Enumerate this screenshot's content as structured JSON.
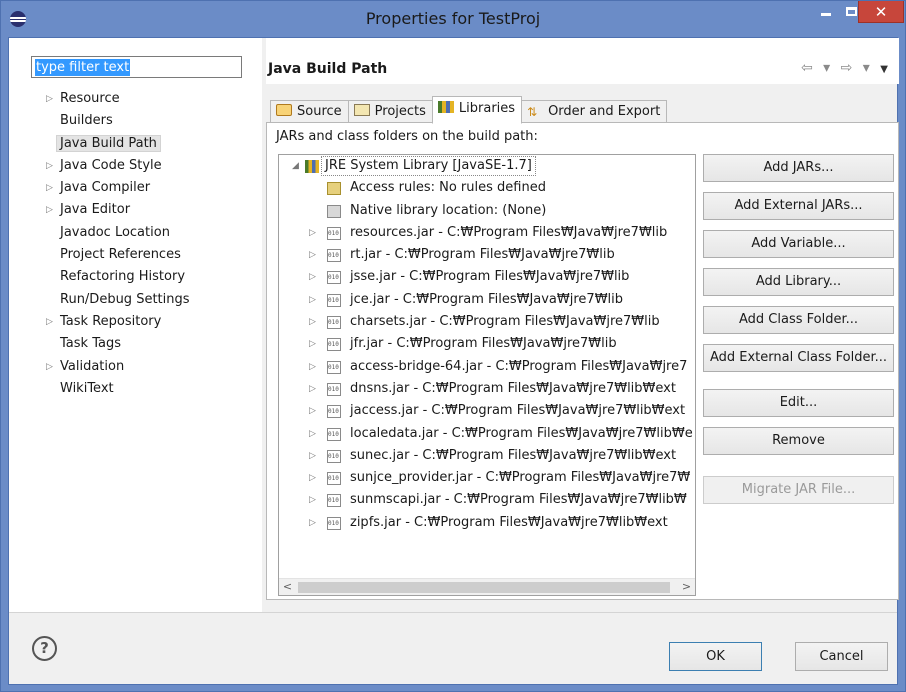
{
  "window": {
    "title": "Properties for TestProj",
    "minimize": "",
    "maximize": "",
    "close": "✕"
  },
  "left": {
    "filter_text": "type filter text",
    "items": [
      {
        "label": "Resource",
        "expandable": true
      },
      {
        "label": "Builders",
        "expandable": false
      },
      {
        "label": "Java Build Path",
        "expandable": false,
        "selected": true
      },
      {
        "label": "Java Code Style",
        "expandable": true
      },
      {
        "label": "Java Compiler",
        "expandable": true
      },
      {
        "label": "Java Editor",
        "expandable": true
      },
      {
        "label": "Javadoc Location",
        "expandable": false
      },
      {
        "label": "Project References",
        "expandable": false
      },
      {
        "label": "Refactoring History",
        "expandable": false
      },
      {
        "label": "Run/Debug Settings",
        "expandable": false
      },
      {
        "label": "Task Repository",
        "expandable": true
      },
      {
        "label": "Task Tags",
        "expandable": false
      },
      {
        "label": "Validation",
        "expandable": true
      },
      {
        "label": "WikiText",
        "expandable": false
      }
    ]
  },
  "page": {
    "title": "Java Build Path",
    "nav_arrows": "⇦ ▾ ⇨ ▾",
    "menu_arrow": "▼"
  },
  "tabs": [
    {
      "label": "Source",
      "active": false,
      "icon": "source-icon"
    },
    {
      "label": "Projects",
      "active": false,
      "icon": "projects-icon"
    },
    {
      "label": "Libraries",
      "active": true,
      "icon": "libraries-icon"
    },
    {
      "label": "Order and Export",
      "active": false,
      "icon": "order-icon"
    }
  ],
  "libraries": {
    "heading": "JARs and class folders on the build path:",
    "root": {
      "label": "JRE System Library [JavaSE-1.7]",
      "expanded": true
    },
    "children": [
      {
        "label": "Access rules: No rules defined",
        "icon": "access-rules-icon",
        "expandable": false
      },
      {
        "label": "Native library location: (None)",
        "icon": "native-library-icon",
        "expandable": false
      },
      {
        "label": "resources.jar - C:₩Program Files₩Java₩jre7₩lib",
        "icon": "jar-icon",
        "expandable": true
      },
      {
        "label": "rt.jar - C:₩Program Files₩Java₩jre7₩lib",
        "icon": "jar-icon",
        "expandable": true
      },
      {
        "label": "jsse.jar - C:₩Program Files₩Java₩jre7₩lib",
        "icon": "jar-icon",
        "expandable": true
      },
      {
        "label": "jce.jar - C:₩Program Files₩Java₩jre7₩lib",
        "icon": "jar-icon",
        "expandable": true
      },
      {
        "label": "charsets.jar - C:₩Program Files₩Java₩jre7₩lib",
        "icon": "jar-icon",
        "expandable": true
      },
      {
        "label": "jfr.jar - C:₩Program Files₩Java₩jre7₩lib",
        "icon": "jar-icon",
        "expandable": true
      },
      {
        "label": "access-bridge-64.jar - C:₩Program Files₩Java₩jre7",
        "icon": "jar-icon",
        "expandable": true
      },
      {
        "label": "dnsns.jar - C:₩Program Files₩Java₩jre7₩lib₩ext",
        "icon": "jar-icon",
        "expandable": true
      },
      {
        "label": "jaccess.jar - C:₩Program Files₩Java₩jre7₩lib₩ext",
        "icon": "jar-icon",
        "expandable": true
      },
      {
        "label": "localedata.jar - C:₩Program Files₩Java₩jre7₩lib₩e",
        "icon": "jar-icon",
        "expandable": true
      },
      {
        "label": "sunec.jar - C:₩Program Files₩Java₩jre7₩lib₩ext",
        "icon": "jar-icon",
        "expandable": true
      },
      {
        "label": "sunjce_provider.jar - C:₩Program Files₩Java₩jre7₩",
        "icon": "jar-icon",
        "expandable": true
      },
      {
        "label": "sunmscapi.jar - C:₩Program Files₩Java₩jre7₩lib₩",
        "icon": "jar-icon",
        "expandable": true
      },
      {
        "label": "zipfs.jar - C:₩Program Files₩Java₩jre7₩lib₩ext",
        "icon": "jar-icon",
        "expandable": true
      }
    ],
    "scroll_left": "<",
    "scroll_right": ">"
  },
  "buttons": [
    {
      "label": "Add JARs...",
      "enabled": true
    },
    {
      "label": "Add External JARs...",
      "enabled": true
    },
    {
      "label": "Add Variable...",
      "enabled": true
    },
    {
      "label": "Add Library...",
      "enabled": true
    },
    {
      "label": "Add Class Folder...",
      "enabled": true
    },
    {
      "label": "Add External Class Folder...",
      "enabled": true
    },
    {
      "label": "Edit...",
      "enabled": true
    },
    {
      "label": "Remove",
      "enabled": true
    },
    {
      "label": "Migrate JAR File...",
      "enabled": false
    }
  ],
  "footer": {
    "help": "?",
    "ok": "OK",
    "cancel": "Cancel"
  },
  "colors": {
    "title_bar": "#6b8cc7",
    "close_button": "#c7463b",
    "selection": "#3399ff"
  }
}
